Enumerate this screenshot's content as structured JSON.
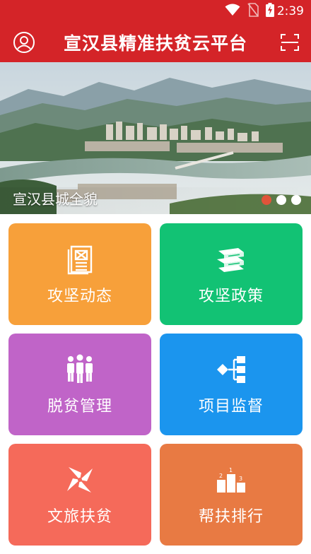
{
  "status_bar": {
    "time": "2:39",
    "icons": [
      "wifi-icon",
      "no-sim-icon",
      "battery-charging-icon"
    ]
  },
  "app_bar": {
    "title": "宣汉县精准扶贫云平台",
    "left_icon": "user-profile-icon",
    "right_icon": "scan-icon",
    "background_color": "#d42428"
  },
  "banner": {
    "caption": "宣汉县城全貌",
    "slide_count": 3,
    "active_slide": 1
  },
  "tiles": [
    {
      "label": "攻坚动态",
      "icon": "news-document-icon",
      "color": "#f7a03a"
    },
    {
      "label": "攻坚政策",
      "icon": "books-stack-icon",
      "color": "#12c274"
    },
    {
      "label": "脱贫管理",
      "icon": "people-group-icon",
      "color": "#c064c8"
    },
    {
      "label": "项目监督",
      "icon": "project-tree-icon",
      "color": "#1b95ee"
    },
    {
      "label": "文旅扶贫",
      "icon": "pinwheel-icon",
      "color": "#f56a5a"
    },
    {
      "label": "帮扶排行",
      "icon": "podium-ranking-icon",
      "color": "#e87a43"
    }
  ]
}
